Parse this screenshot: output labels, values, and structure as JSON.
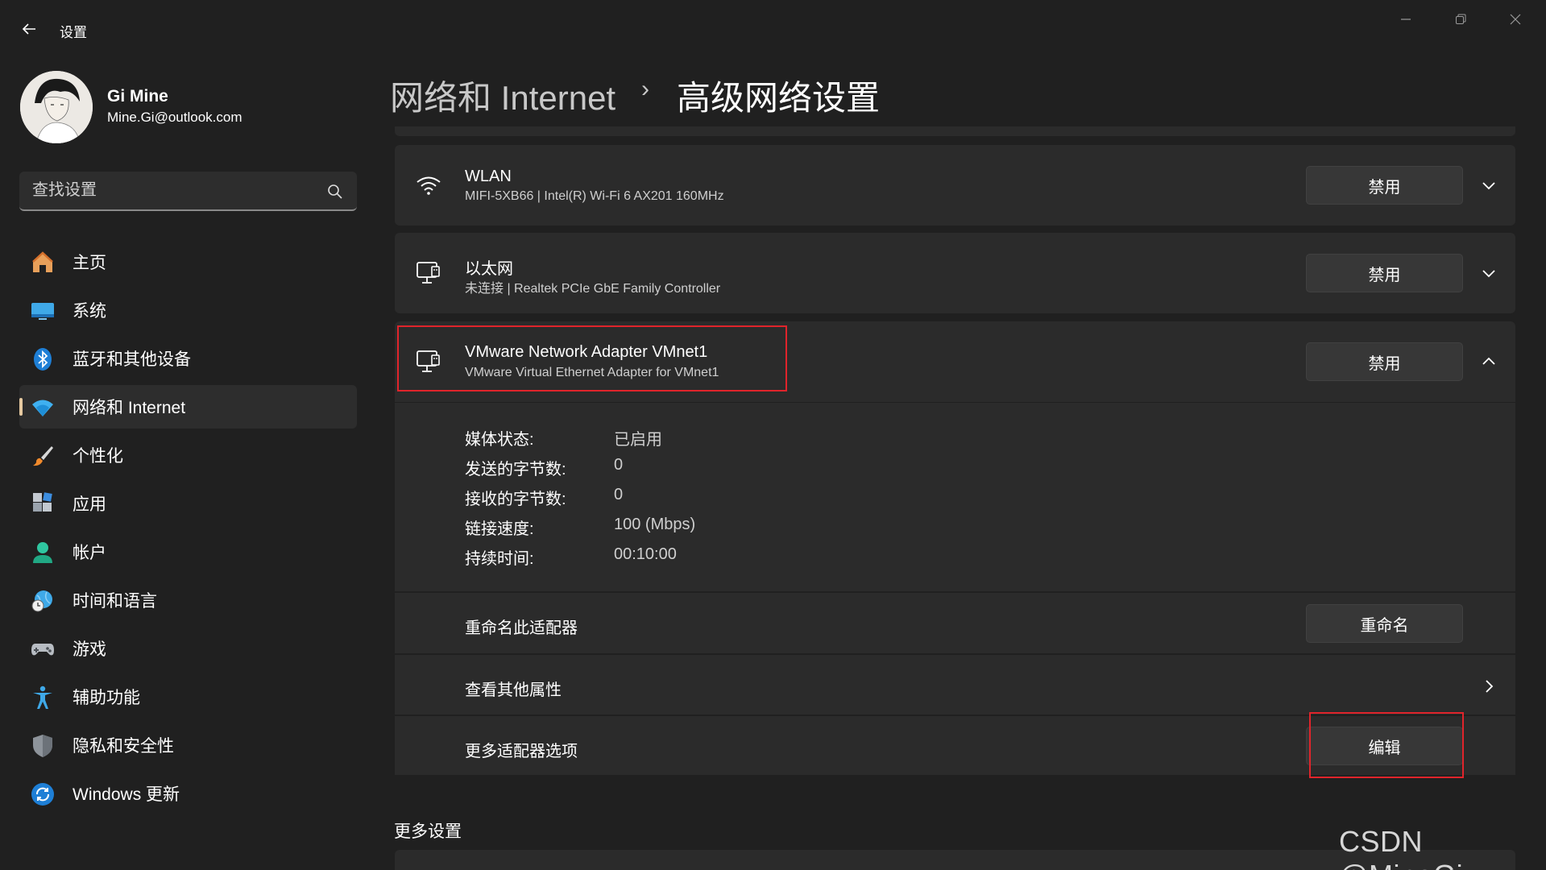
{
  "window": {
    "title": "设置"
  },
  "user": {
    "name": "Gi Mine",
    "email": "Mine.Gi@outlook.com"
  },
  "search": {
    "placeholder": "查找设置"
  },
  "nav": {
    "items": [
      {
        "label": "主页",
        "icon": "home-icon"
      },
      {
        "label": "系统",
        "icon": "monitor-icon"
      },
      {
        "label": "蓝牙和其他设备",
        "icon": "bluetooth-icon"
      },
      {
        "label": "网络和 Internet",
        "icon": "wifi-icon",
        "active": true
      },
      {
        "label": "个性化",
        "icon": "brush-icon"
      },
      {
        "label": "应用",
        "icon": "apps-icon"
      },
      {
        "label": "帐户",
        "icon": "account-icon"
      },
      {
        "label": "时间和语言",
        "icon": "globe-clock-icon"
      },
      {
        "label": "游戏",
        "icon": "gamepad-icon"
      },
      {
        "label": "辅助功能",
        "icon": "accessibility-icon"
      },
      {
        "label": "隐私和安全性",
        "icon": "shield-icon"
      },
      {
        "label": "Windows 更新",
        "icon": "update-icon"
      }
    ]
  },
  "breadcrumb": {
    "parent": "网络和 Internet",
    "separator": "›",
    "current": "高级网络设置"
  },
  "adapters": [
    {
      "title": "WLAN",
      "subtitle": "MIFI-5XB66 | Intel(R) Wi-Fi 6 AX201 160MHz",
      "button": "禁用",
      "icon": "wifi-icon"
    },
    {
      "title": "以太网",
      "subtitle": "未连接 | Realtek PCIe GbE Family Controller",
      "button": "禁用",
      "icon": "ethernet-icon"
    },
    {
      "title": "VMware Network Adapter VMnet1",
      "subtitle": "VMware Virtual Ethernet Adapter for VMnet1",
      "button": "禁用",
      "icon": "ethernet-icon"
    }
  ],
  "details": [
    {
      "label": "媒体状态:",
      "value": "已启用"
    },
    {
      "label": "发送的字节数:",
      "value": "0"
    },
    {
      "label": "接收的字节数:",
      "value": "0"
    },
    {
      "label": "链接速度:",
      "value": "100 (Mbps)"
    },
    {
      "label": "持续时间:",
      "value": "00:10:00"
    }
  ],
  "options": {
    "rename_label": "重命名此适配器",
    "rename_button": "重命名",
    "properties_label": "查看其他属性",
    "more_options_label": "更多适配器选项",
    "edit_button": "编辑"
  },
  "more_settings": {
    "title": "更多设置"
  },
  "watermark": "CSDN @MineGi",
  "colors": {
    "background": "#202020",
    "card": "#2b2b2b",
    "highlight": "#e0242b",
    "accent": "#60cdff"
  }
}
